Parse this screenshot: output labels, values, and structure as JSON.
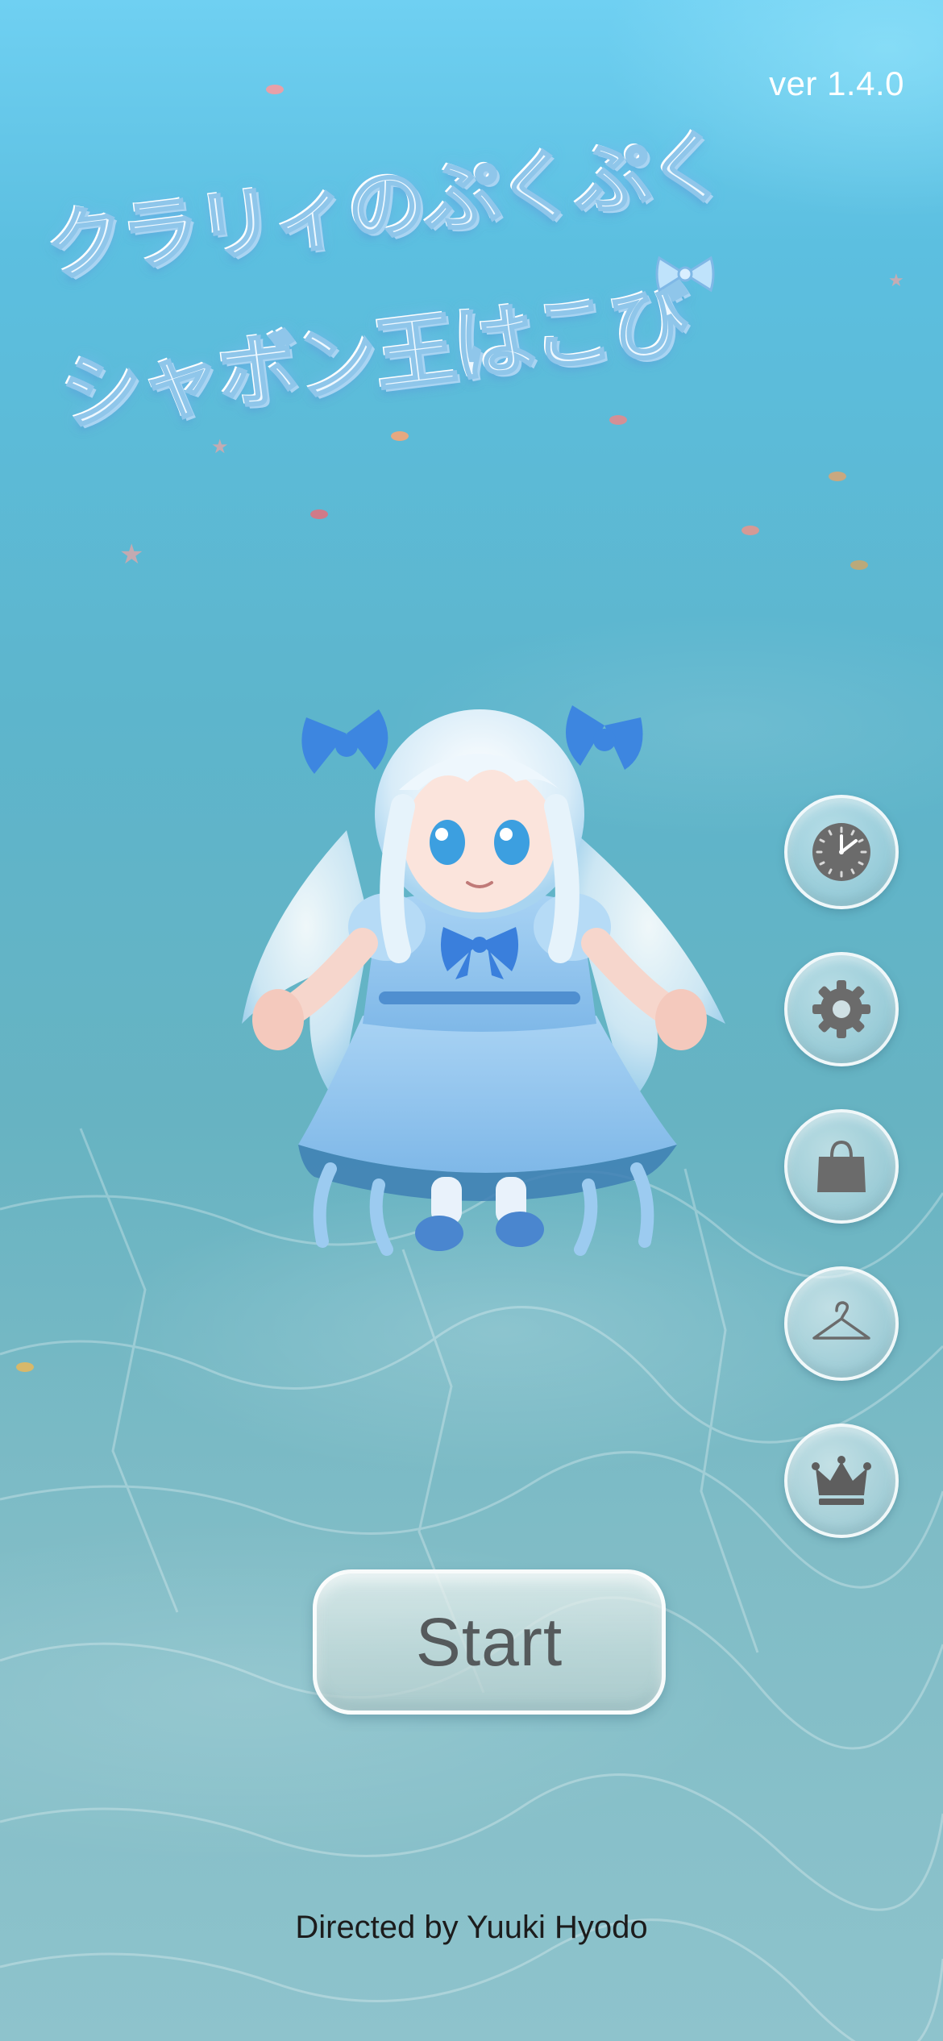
{
  "version_label": "ver 1.4.0",
  "logo": {
    "line1": "クラリィのぷくぷく",
    "line2": "シャボン王はこび"
  },
  "side_buttons": [
    {
      "icon": "clock-icon",
      "name": "time-button"
    },
    {
      "icon": "gear-icon",
      "name": "settings-button"
    },
    {
      "icon": "shopping-bag-icon",
      "name": "shop-button"
    },
    {
      "icon": "hanger-icon",
      "name": "wardrobe-button"
    },
    {
      "icon": "crown-icon",
      "name": "ranking-button"
    }
  ],
  "start_label": "Start",
  "credit": "Directed by Yuuki Hyodo",
  "colors": {
    "sea_top": "#6fd0f2",
    "sea_bottom": "#8ec3cc",
    "icon_gray": "#6b6b6b",
    "dress_blue": "#8cc4ef",
    "bow_blue": "#3d86e0"
  }
}
